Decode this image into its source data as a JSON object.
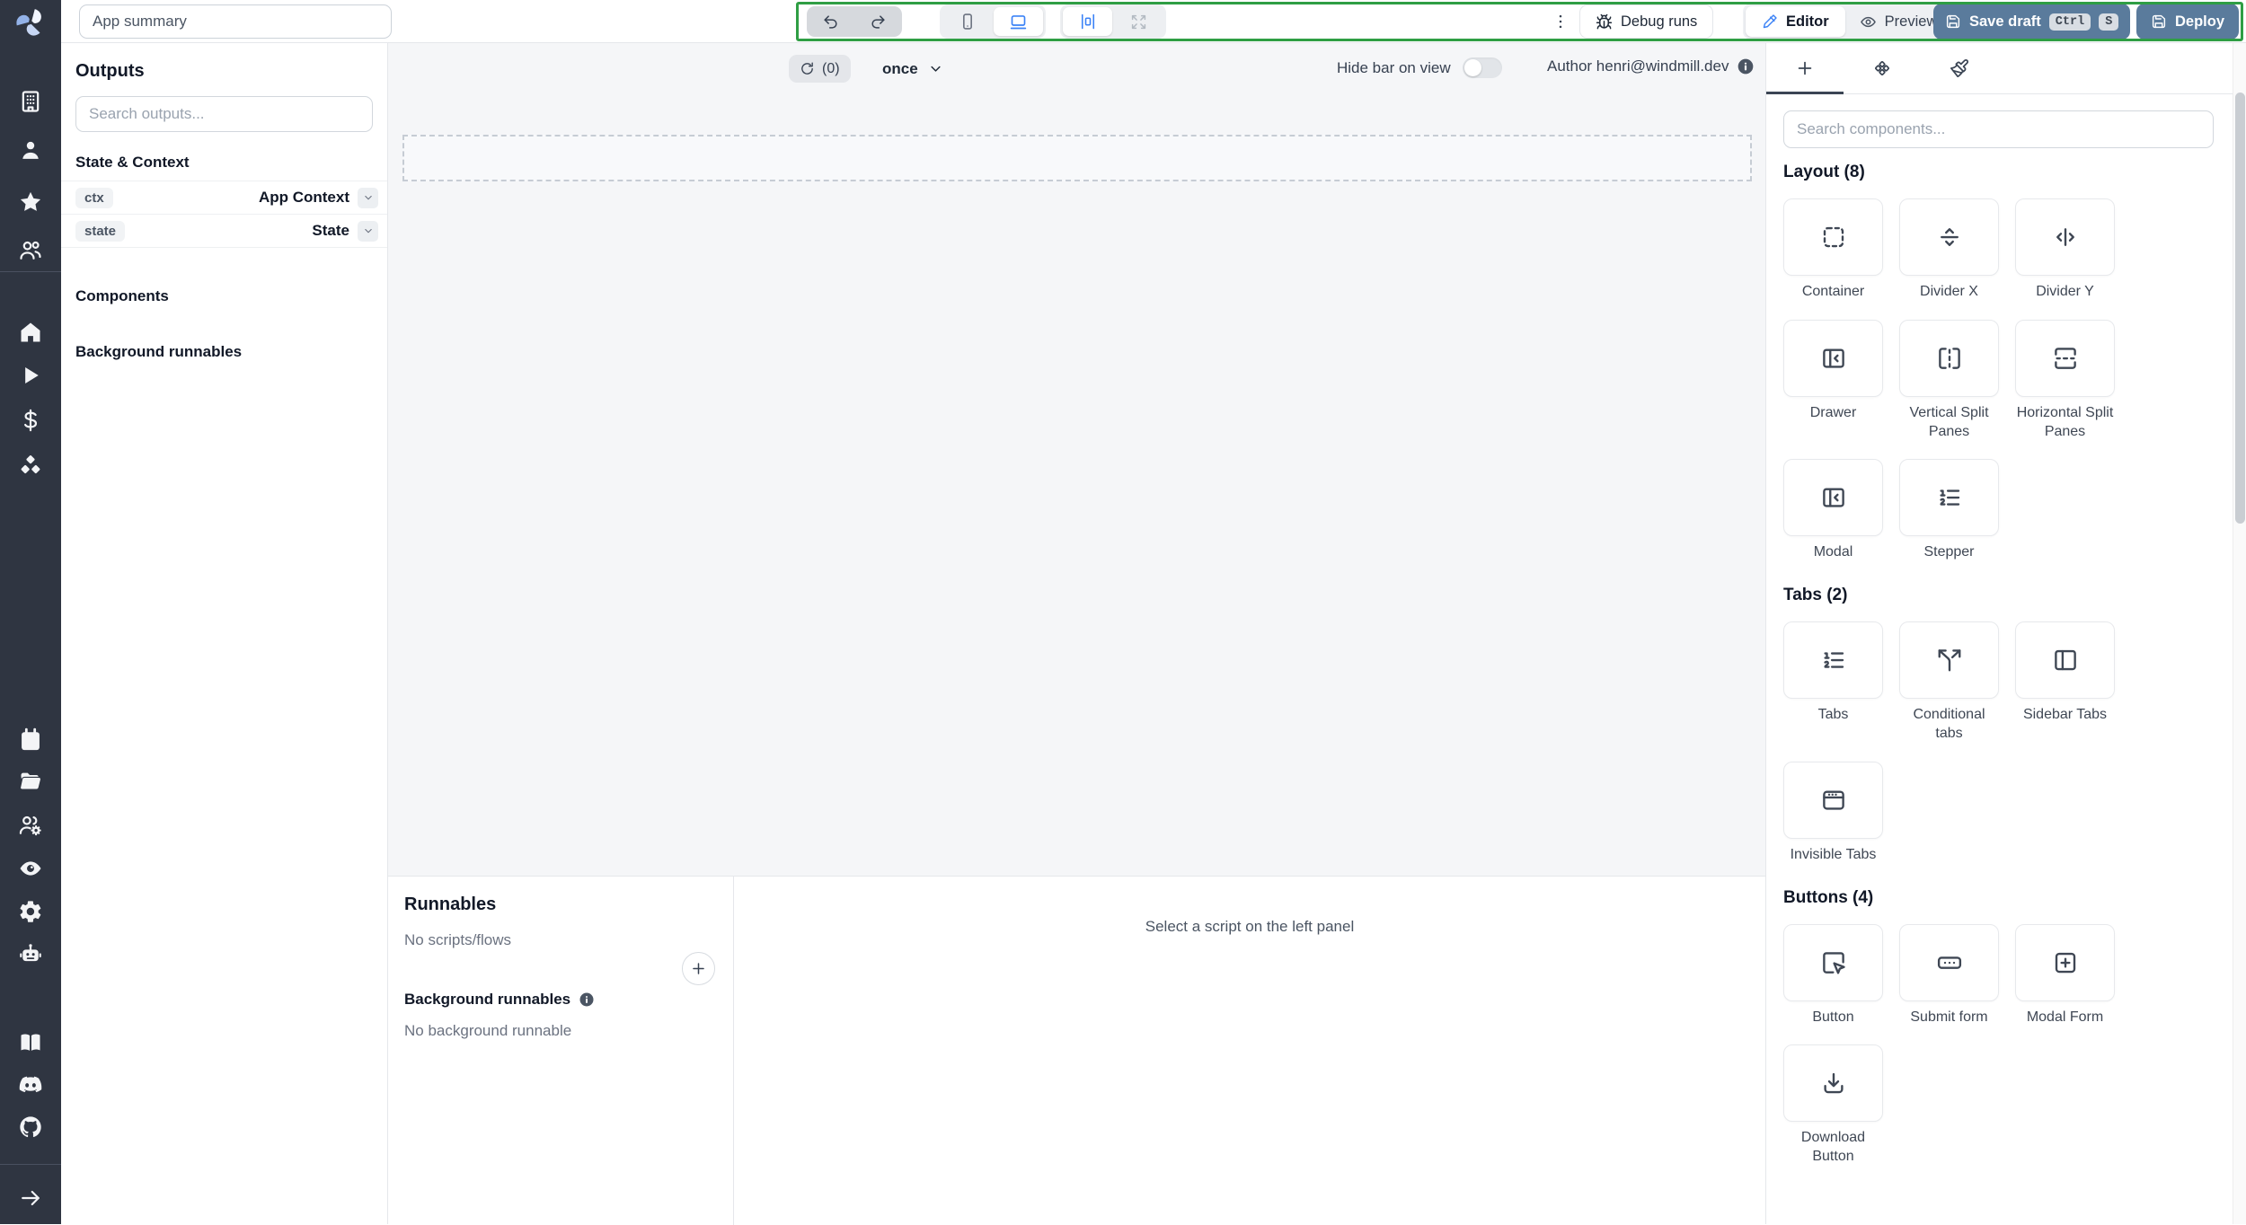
{
  "topbar": {
    "app_summary": "App summary",
    "debug_runs": "Debug runs",
    "editor": "Editor",
    "preview": "Preview",
    "save_draft": "Save draft",
    "save_shortcut": [
      "Ctrl",
      "S"
    ],
    "deploy": "Deploy"
  },
  "sidebar": {
    "icons": [
      "building",
      "user",
      "star",
      "users",
      "home",
      "play",
      "dollar",
      "boxes",
      "calendar",
      "folder-open",
      "users-cog",
      "eye-filled",
      "gear",
      "bot",
      "book-open",
      "discord",
      "github",
      "arrow-right"
    ]
  },
  "outputs_panel": {
    "title": "Outputs",
    "search_placeholder": "Search outputs...",
    "state_context_header": "State & Context",
    "rows": [
      {
        "key": "ctx",
        "value": "App Context"
      },
      {
        "key": "state",
        "value": "State"
      }
    ],
    "components_header": "Components",
    "background_header": "Background runnables"
  },
  "canvas": {
    "refresh_count": "(0)",
    "run_mode": "once",
    "hide_bar_label": "Hide bar on view",
    "author_label": "Author henri@windmill.dev"
  },
  "runnables": {
    "title": "Runnables",
    "no_scripts": "No scripts/flows",
    "background_title": "Background runnables",
    "no_background": "No background runnable",
    "select_script_hint": "Select a script on the left panel"
  },
  "components_panel": {
    "search_placeholder": "Search components...",
    "sections": [
      {
        "title": "Layout (8)",
        "items": [
          {
            "label": "Container",
            "icon": "container"
          },
          {
            "label": "Divider X",
            "icon": "divider-x"
          },
          {
            "label": "Divider Y",
            "icon": "divider-y"
          },
          {
            "label": "Drawer",
            "icon": "drawer"
          },
          {
            "label": "Vertical Split Panes",
            "icon": "vertical-split"
          },
          {
            "label": "Horizontal Split Panes",
            "icon": "horizontal-split"
          },
          {
            "label": "Modal",
            "icon": "drawer"
          },
          {
            "label": "Stepper",
            "icon": "list-ordered"
          }
        ]
      },
      {
        "title": "Tabs (2)",
        "items": [
          {
            "label": "Tabs",
            "icon": "list-ordered"
          },
          {
            "label": "Conditional tabs",
            "icon": "split"
          },
          {
            "label": "Sidebar Tabs",
            "icon": "panel-left"
          },
          {
            "label": "Invisible Tabs",
            "icon": "app-window"
          }
        ]
      },
      {
        "title": "Buttons (4)",
        "items": [
          {
            "label": "Button",
            "icon": "mouse-click"
          },
          {
            "label": "Submit form",
            "icon": "rect-ellipsis"
          },
          {
            "label": "Modal Form",
            "icon": "square-plus"
          },
          {
            "label": "Download Button",
            "icon": "download"
          }
        ]
      }
    ]
  },
  "colors": {
    "sidebar_bg": "#2f3541",
    "accent_blue": "#3b82f6",
    "primary_button": "#5a7b9c",
    "annotation_green": "#2f9e44",
    "canvas_bg": "#f5f6f8"
  }
}
